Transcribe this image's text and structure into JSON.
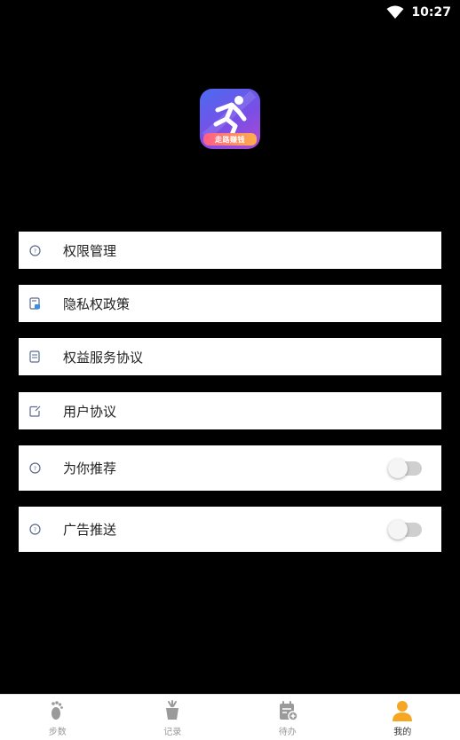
{
  "status_bar": {
    "time": "10:27",
    "icons": [
      "wifi-icon"
    ]
  },
  "app": {
    "logo_icon": "running-man-icon",
    "logo_badge_text": "走路赚钱",
    "colors": {
      "logo_gradient_start": "#4a6cf0",
      "logo_gradient_end": "#b04ad0",
      "badge_start": "#ff5c8a",
      "badge_end": "#ffb04a"
    }
  },
  "menu": {
    "items": [
      {
        "label": "权限管理",
        "icon": "info-circle-icon"
      },
      {
        "label": "隐私权政策",
        "icon": "privacy-doc-icon"
      },
      {
        "label": "权益服务协议",
        "icon": "document-icon"
      },
      {
        "label": "用户协议",
        "icon": "edit-doc-icon"
      },
      {
        "label": "为你推荐",
        "icon": "info-circle-icon",
        "toggle": false
      },
      {
        "label": "广告推送",
        "icon": "info-circle-icon",
        "toggle": false
      }
    ]
  },
  "bottom_nav": {
    "items": [
      {
        "label": "步数",
        "icon": "footprint-icon",
        "active": false
      },
      {
        "label": "记录",
        "icon": "cup-icon",
        "active": false
      },
      {
        "label": "待办",
        "icon": "calendar-add-icon",
        "active": false
      },
      {
        "label": "我的",
        "icon": "person-icon",
        "active": true
      }
    ],
    "colors": {
      "active": "#f5a623",
      "inactive": "#9a9a9a"
    }
  }
}
